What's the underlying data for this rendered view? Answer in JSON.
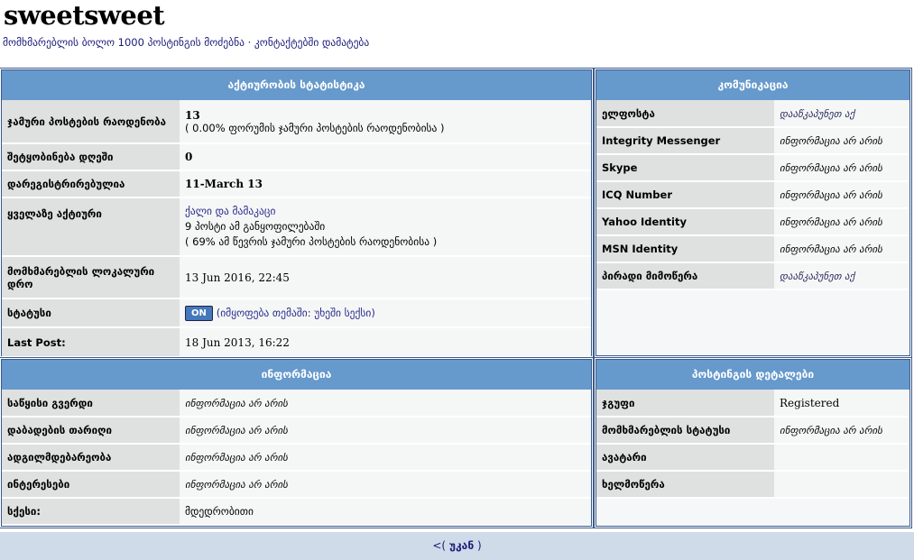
{
  "page": {
    "title": "sweetsweet",
    "find_posts": "მომხმარებლის ბოლო 1000 პოსტინგის მოძებნა",
    "sep": " · ",
    "add_contact": "კონტაქტებში დამატება"
  },
  "activity": {
    "title": "აქტიურობის სტატისტიკა",
    "total_label": "ჯამური პოსტების რაოდენობა",
    "total_value": "13",
    "total_pct": "( 0.00% ფორუმის ჯამური პოსტების რაოდენობისა )",
    "perday_label": "შეტყობინება დღეში",
    "perday_value": "0",
    "reg_label": "დარეგისტრირებულია",
    "reg_value": "11-March 13",
    "active_label": "ყველაზე აქტიური",
    "active_forum": "ქალი და მამაკაცი",
    "active_posts": "9 პოსტი ამ განყოფილებაში",
    "active_pct": "( 69% ამ წევრის ჯამური პოსტების რაოდენობისა )",
    "time_label": "მომხმარებლის ლოკალური დრო",
    "time_value": "13 Jun 2016, 22:45",
    "status_label": "სტატუსი",
    "status_badge": "ON",
    "status_text": "(იმყოფება თემაში: უხეში სექსი)",
    "last_label": "Last Post:",
    "last_value": "18 Jun 2013, 16:22"
  },
  "comm": {
    "title": "კომუნიკაცია",
    "rows": [
      {
        "label": "ელფოსტა",
        "value": "დააწკაპუნეთ აქ",
        "link": true
      },
      {
        "label": "Integrity Messenger",
        "value": "ინფორმაცია არ არის"
      },
      {
        "label": "Skype",
        "value": "ინფორმაცია არ არის"
      },
      {
        "label": "ICQ Number",
        "value": "ინფორმაცია არ არის"
      },
      {
        "label": "Yahoo Identity",
        "value": "ინფორმაცია არ არის"
      },
      {
        "label": "MSN Identity",
        "value": "ინფორმაცია არ არის"
      },
      {
        "label": "პირადი მიმოწერა",
        "value": "დააწკაპუნეთ აქ",
        "link": true
      }
    ]
  },
  "info": {
    "title": "ინფორმაცია",
    "rows": [
      {
        "label": "საწყისი გვერდი",
        "value": "ინფორმაცია არ არის"
      },
      {
        "label": "დაბადების თარიღი",
        "value": "ინფორმაცია არ არის"
      },
      {
        "label": "ადგილმდებარეობა",
        "value": "ინფორმაცია არ არის"
      },
      {
        "label": "ინტერესები",
        "value": "ინფორმაცია არ არის"
      },
      {
        "label": "სქესი:",
        "value": "მდედრობითი"
      }
    ]
  },
  "posting": {
    "title": "პოსტინგის დეტალები",
    "rows": [
      {
        "label": "ჯგუფი",
        "value": "Registered"
      },
      {
        "label": "მომხმარებლის სტატუსი",
        "value": "ინფორმაცია არ არის"
      },
      {
        "label": "ავატარი",
        "value": ""
      },
      {
        "label": "ხელმოწერა",
        "value": ""
      }
    ]
  },
  "footer": {
    "prefix": "<( ",
    "back": "უკან",
    "suffix": " )"
  }
}
